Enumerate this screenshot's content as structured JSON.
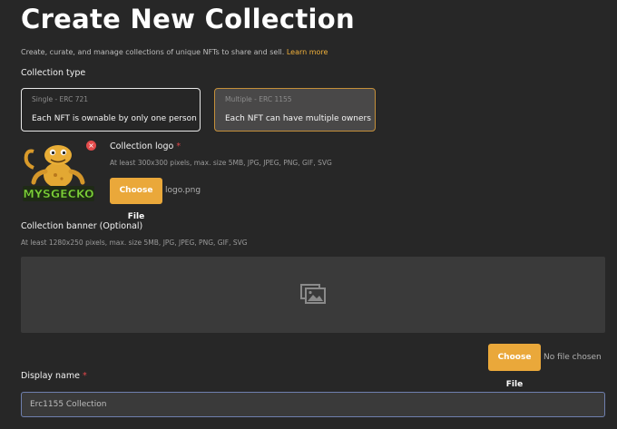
{
  "page": {
    "title": "Create New Collection",
    "subtitle": "Create, curate, and manage collections of unique NFTs to share and sell.",
    "learn_more": "Learn more"
  },
  "collection_type": {
    "label": "Collection type",
    "options": [
      {
        "caption": "Single - ERC 721",
        "description": "Each NFT is ownable by only one person"
      },
      {
        "caption": "Multiple - ERC 1155",
        "description": "Each NFT can have multiple owners"
      }
    ]
  },
  "logo": {
    "label": "Collection logo",
    "required_mark": "*",
    "hint": "At least 300x300 pixels, max. size 5MB, JPG, JPEG, PNG, GIF, SVG",
    "button": "Choose File",
    "file_name": "logo.png",
    "preview_text": "MYSGECKO",
    "remove_symbol": "×"
  },
  "banner": {
    "label": "Collection banner (Optional)",
    "hint": "At least 1280x250 pixels, max. size 5MB, JPG, JPEG, PNG, GIF, SVG",
    "button": "Choose File",
    "file_name": "No file chosen"
  },
  "display_name": {
    "label": "Display name",
    "required_mark": "*",
    "value": "Erc1155 Collection"
  },
  "colors": {
    "background": "#272727",
    "accent": "#eaa83a",
    "required": "#e0464a",
    "input_border": "#6f7fae"
  }
}
